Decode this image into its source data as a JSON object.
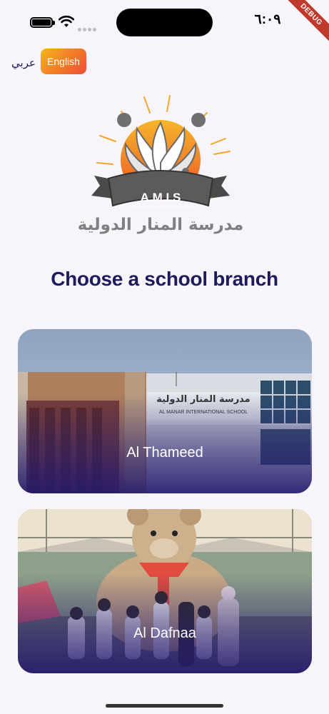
{
  "status_bar": {
    "time": "٦:٠٩",
    "debug_label": "DEBUG",
    "battery_icon": "battery-icon",
    "wifi_icon": "wifi-icon",
    "signal_icon": "cellular-signal-icon"
  },
  "language": {
    "arabic_label": "عربي",
    "english_label": "English",
    "selected": "English"
  },
  "logo": {
    "acronym": "A.M.I.S",
    "english_name": "Al Manar International School",
    "arabic_name": "مدرسة المنار الدولية"
  },
  "page": {
    "title": "Choose a school branch"
  },
  "branches": [
    {
      "label": "Al Thameed",
      "photo": "school-building-photo"
    },
    {
      "label": "Al Dafnaa",
      "photo": "children-with-teddy-bear-photo"
    }
  ],
  "colors": {
    "accent_gradient_start": "#f4b619",
    "accent_gradient_end": "#ec4b3b",
    "title": "#1e1b5c",
    "card_overlay": "#231970",
    "background": "#f7f4fc"
  }
}
